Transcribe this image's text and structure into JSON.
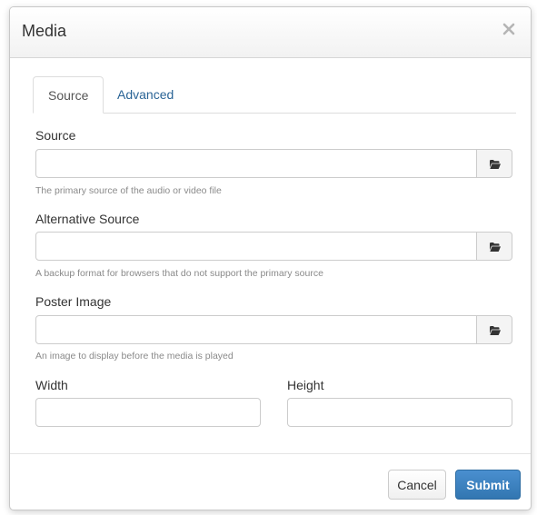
{
  "dialog": {
    "title": "Media",
    "close_icon": "close-x-icon"
  },
  "tabs": [
    {
      "label": "Source",
      "active": true
    },
    {
      "label": "Advanced",
      "active": false
    }
  ],
  "fields": {
    "source": {
      "label": "Source",
      "value": "",
      "help": "The primary source of the audio or video file",
      "button_icon": "folder-open-icon"
    },
    "alt_source": {
      "label": "Alternative Source",
      "value": "",
      "help": "A backup format for browsers that do not support the primary source",
      "button_icon": "folder-open-icon"
    },
    "poster": {
      "label": "Poster Image",
      "value": "",
      "help": "An image to display before the media is played",
      "button_icon": "folder-open-icon"
    },
    "width": {
      "label": "Width",
      "value": ""
    },
    "height": {
      "label": "Height",
      "value": ""
    }
  },
  "footer": {
    "cancel_label": "Cancel",
    "submit_label": "Submit"
  },
  "colors": {
    "accent": "#3276b1",
    "link": "#2a6496",
    "text": "#333333",
    "help_text": "#8a8a8a",
    "border": "#cccccc"
  }
}
